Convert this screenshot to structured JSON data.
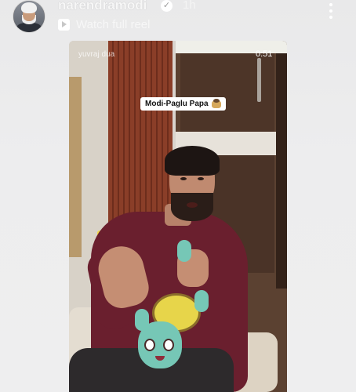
{
  "header": {
    "username": "narendramodi",
    "verified_icon": "verified-badge-icon",
    "time_ago": "1h",
    "watch_full_reel": "Watch full reel",
    "reel_icon": "reel-play-icon",
    "more_icon": "more-vertical-icon"
  },
  "video": {
    "watermark": "yuvraj dua",
    "duration": "0:51",
    "caption": "Modi-Paglu Papa"
  },
  "colors": {
    "header_text": "#f7f7f7",
    "shirt": "#6a1f2e",
    "toy": "#76c7b6"
  }
}
